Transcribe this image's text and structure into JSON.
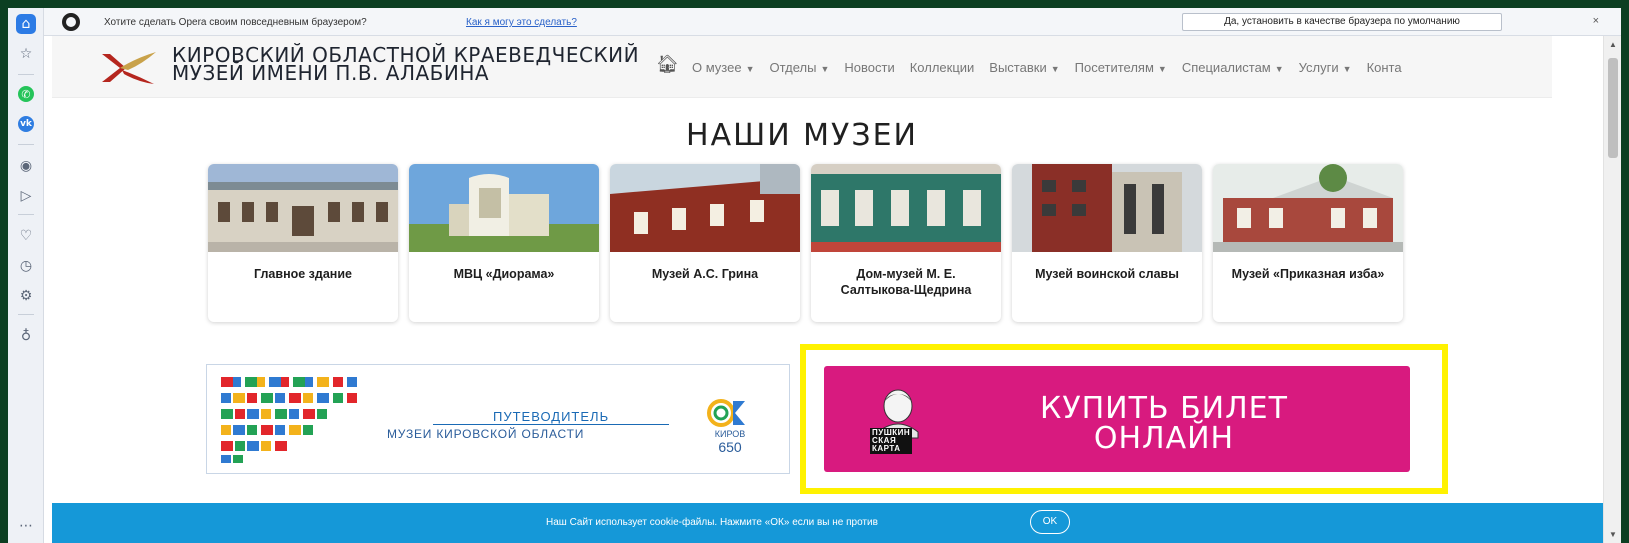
{
  "infobar": {
    "text": "Хотите сделать Opera своим повседневным браузером?",
    "link": "Как я могу это сделать?",
    "button": "Да, установить в качестве браузера по умолчанию",
    "close": "×"
  },
  "site": {
    "title_line1": "КИРОВСКИЙ ОБЛАСТНОЙ КРАЕВЕДЧЕСКИЙ",
    "title_line2": "МУЗЕЙ ИМЕНИ П.В. АЛАБИНА"
  },
  "nav": {
    "home_icon": "home-icon",
    "items": [
      {
        "label": "О музее",
        "dropdown": true
      },
      {
        "label": "Отделы",
        "dropdown": true
      },
      {
        "label": "Новости",
        "dropdown": false
      },
      {
        "label": "Коллекции",
        "dropdown": false
      },
      {
        "label": "Выставки",
        "dropdown": true
      },
      {
        "label": "Посетителям",
        "dropdown": true
      },
      {
        "label": "Специалистам",
        "dropdown": true
      },
      {
        "label": "Услуги",
        "dropdown": true
      },
      {
        "label": "Конта",
        "dropdown": false
      }
    ],
    "caret": "▼"
  },
  "section_title": "НАШИ МУЗЕИ",
  "museums": [
    {
      "name": "Главное здание",
      "color": "#c9c2b3"
    },
    {
      "name": "МВЦ «Диорама»",
      "color": "#e8e6d6"
    },
    {
      "name": "Музей А.С. Грина",
      "color": "#9b3a2a"
    },
    {
      "name": "Дом-музей М. Е. Салтыкова-Щедрина",
      "color": "#2f7a6b"
    },
    {
      "name": "Музей воинской славы",
      "color": "#8a2f27"
    },
    {
      "name": "Музей «Приказная изба»",
      "color": "#a8483d"
    }
  ],
  "guide": {
    "title": "ПУТЕВОДИТЕЛЬ",
    "subtitle": "МУЗЕИ КИРОВСКОЙ ОБЛАСТИ",
    "kirov_label": "КИРОВ",
    "kirov_number": "650"
  },
  "buy": {
    "line1": "КУПИТЬ БИЛЕТ",
    "line2": "ОНЛАЙН",
    "pushkin_line1": "ПУШКИН",
    "pushkin_line2": "СКАЯ",
    "pushkin_line3": "КАРТА",
    "highlight_color": "#fff200",
    "bg_color": "#d81a7f"
  },
  "cookie": {
    "text": "Наш Сайт использует cookie-файлы. Нажмите «ОК» если вы не против",
    "ok": "OK"
  },
  "sidebar": [
    "home-icon",
    "star-icon",
    "whatsapp-icon",
    "vk-icon",
    "player-icon",
    "send-icon",
    "heart-icon",
    "history-icon",
    "settings-icon",
    "lightbulb-icon"
  ]
}
